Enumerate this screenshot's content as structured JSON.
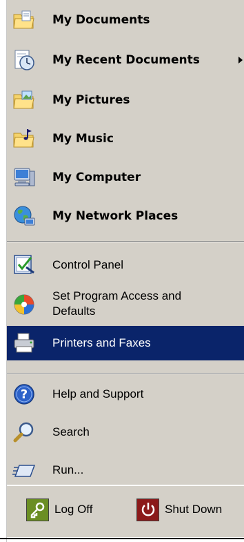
{
  "menu": {
    "items": [
      {
        "label": "My Documents",
        "icon": "my-documents-folder-icon"
      },
      {
        "label": "My Recent Documents",
        "icon": "recent-documents-clock-icon",
        "submenu": true
      },
      {
        "label": "My Pictures",
        "icon": "my-pictures-folder-icon"
      },
      {
        "label": "My Music",
        "icon": "my-music-folder-icon"
      },
      {
        "label": "My Computer",
        "icon": "my-computer-icon"
      },
      {
        "label": "My Network Places",
        "icon": "network-places-globe-icon"
      },
      {
        "label": "Control Panel",
        "icon": "control-panel-icon"
      },
      {
        "label": "Set Program Access and Defaults",
        "line1": "Set Program Access and",
        "line2": "Defaults",
        "icon": "program-defaults-icon"
      },
      {
        "label": "Printers and Faxes",
        "icon": "printer-icon",
        "selected": true
      },
      {
        "label": "Help and Support",
        "icon": "help-icon"
      },
      {
        "label": "Search",
        "icon": "search-magnifier-icon"
      },
      {
        "label": "Run...",
        "icon": "run-icon"
      }
    ]
  },
  "footer": {
    "log_off_label": "Log Off",
    "shut_down_label": "Shut Down"
  },
  "colors": {
    "menu_background": "#d4d0c8",
    "selection_background": "#0a246a",
    "selection_text": "#ffffff",
    "log_off_icon_bg": "#6b8e23",
    "shut_down_icon_bg": "#8b1a1a"
  }
}
